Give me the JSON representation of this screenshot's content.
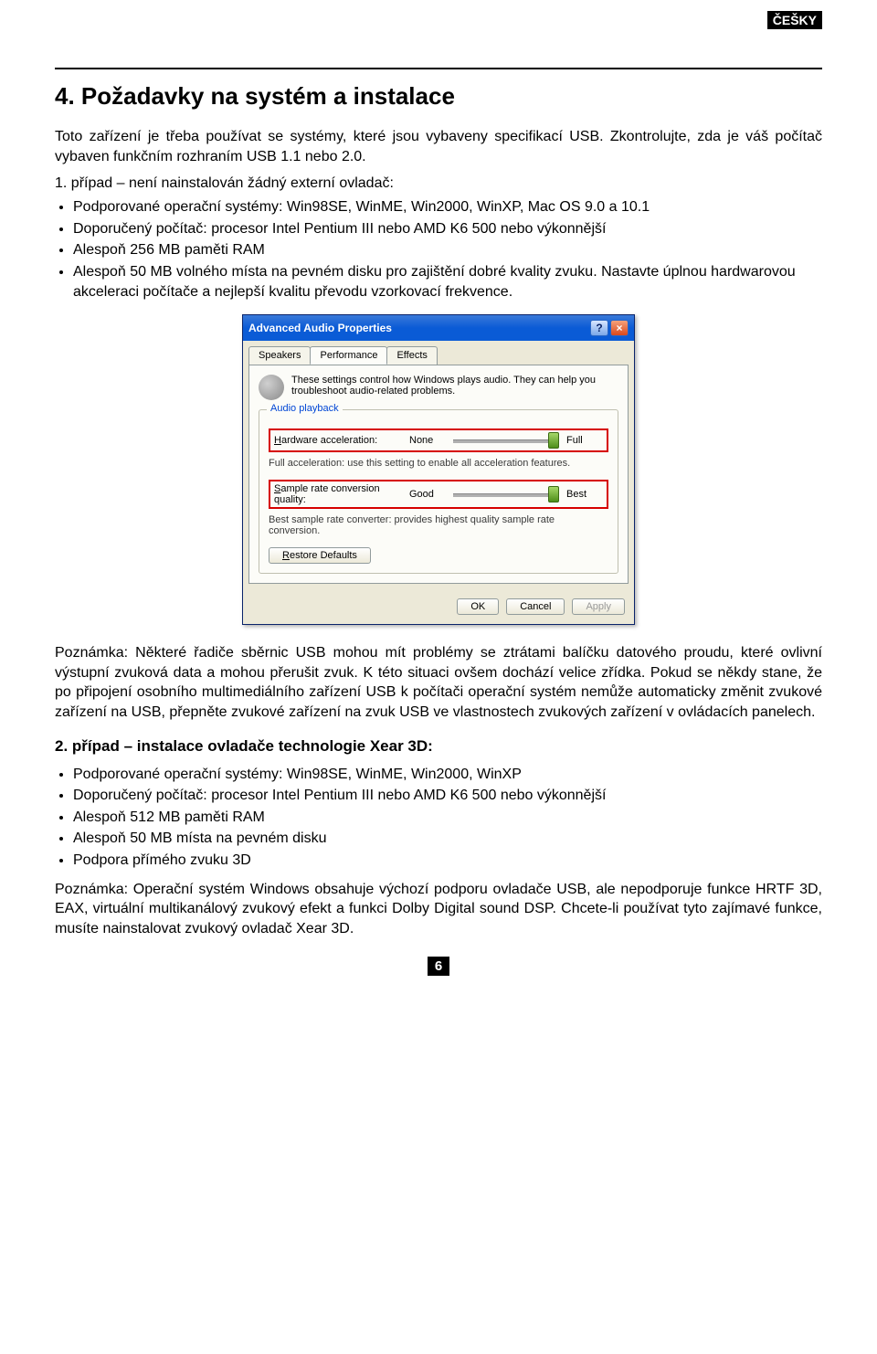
{
  "header": {
    "lang_badge": "ČEŠKY",
    "section_title": "4. Požadavky na systém a instalace"
  },
  "intro": "Toto zařízení je třeba používat se systémy, které jsou vybaveny specifikací USB. Zkontrolujte, zda je váš počítač vybaven funkčním rozhraním USB 1.1 nebo 2.0.",
  "case1_title": "1. případ – není nainstalován žádný externí ovladač:",
  "case1_bullets": [
    "Podporované operační systémy: Win98SE, WinME, Win2000, WinXP, Mac OS 9.0 a 10.1",
    "Doporučený počítač: procesor Intel Pentium III nebo AMD K6 500 nebo výkonnější",
    "Alespoň 256 MB paměti RAM",
    "Alespoň 50 MB volného místa na pevném disku pro zajištění dobré kvality zvuku. Nastavte úplnou hardwarovou akceleraci počítače a nejlepší kvalitu převodu vzorkovací frekvence."
  ],
  "dialog": {
    "title": "Advanced Audio Properties",
    "help_icon": "?",
    "close_icon": "×",
    "tabs": {
      "speakers": "Speakers",
      "performance": "Performance",
      "effects": "Effects"
    },
    "desc": "These settings control how Windows plays audio. They can help you troubleshoot audio-related problems.",
    "group_legend": "Audio playback",
    "hw_label_pre": "Hardware acceleration:",
    "hw_underline": "H",
    "hw_none": "None",
    "hw_full": "Full",
    "hw_hint": "Full acceleration: use this setting to enable all acceleration features.",
    "sr_label_pre": "ample rate conversion quality:",
    "sr_underline": "S",
    "sr_good": "Good",
    "sr_best": "Best",
    "sr_hint": "Best sample rate converter: provides highest quality sample rate conversion.",
    "restore": "Restore Defaults",
    "restore_underline": "R",
    "ok": "OK",
    "cancel": "Cancel",
    "apply": "Apply"
  },
  "note1_prefix": "Poznámka: ",
  "note1_body": "Některé řadiče sběrnic USB mohou mít problémy se ztrátami balíčku datového proudu, které ovlivní výstupní zvuková data a mohou přerušit zvuk. K této situaci ovšem dochází velice zřídka. Pokud se někdy stane, že po připojení osobního multimediálního zařízení USB k počítači operační systém nemůže automaticky změnit zvukové zařízení na USB, přepněte zvukové zařízení na zvuk USB ve vlastnostech zvukových zařízení v ovládacích panelech.",
  "case2_title": "2. případ – instalace ovladače technologie Xear 3D:",
  "case2_bullets": [
    "Podporované operační systémy: Win98SE, WinME, Win2000, WinXP",
    "Doporučený počítač: procesor Intel Pentium III nebo AMD K6 500 nebo výkonnější",
    "Alespoň 512 MB paměti RAM",
    "Alespoň 50 MB místa na pevném disku",
    "Podpora přímého zvuku 3D"
  ],
  "note2_prefix": "Poznámka: ",
  "note2_body": "Operační systém Windows obsahuje výchozí podporu ovladače USB, ale nepodporuje funkce HRTF 3D, EAX, virtuální multikanálový zvukový efekt a funkci Dolby Digital sound DSP. Chcete-li používat tyto zajímavé funkce, musíte nainstalovat zvukový ovladač Xear 3D.",
  "page_number": "6"
}
